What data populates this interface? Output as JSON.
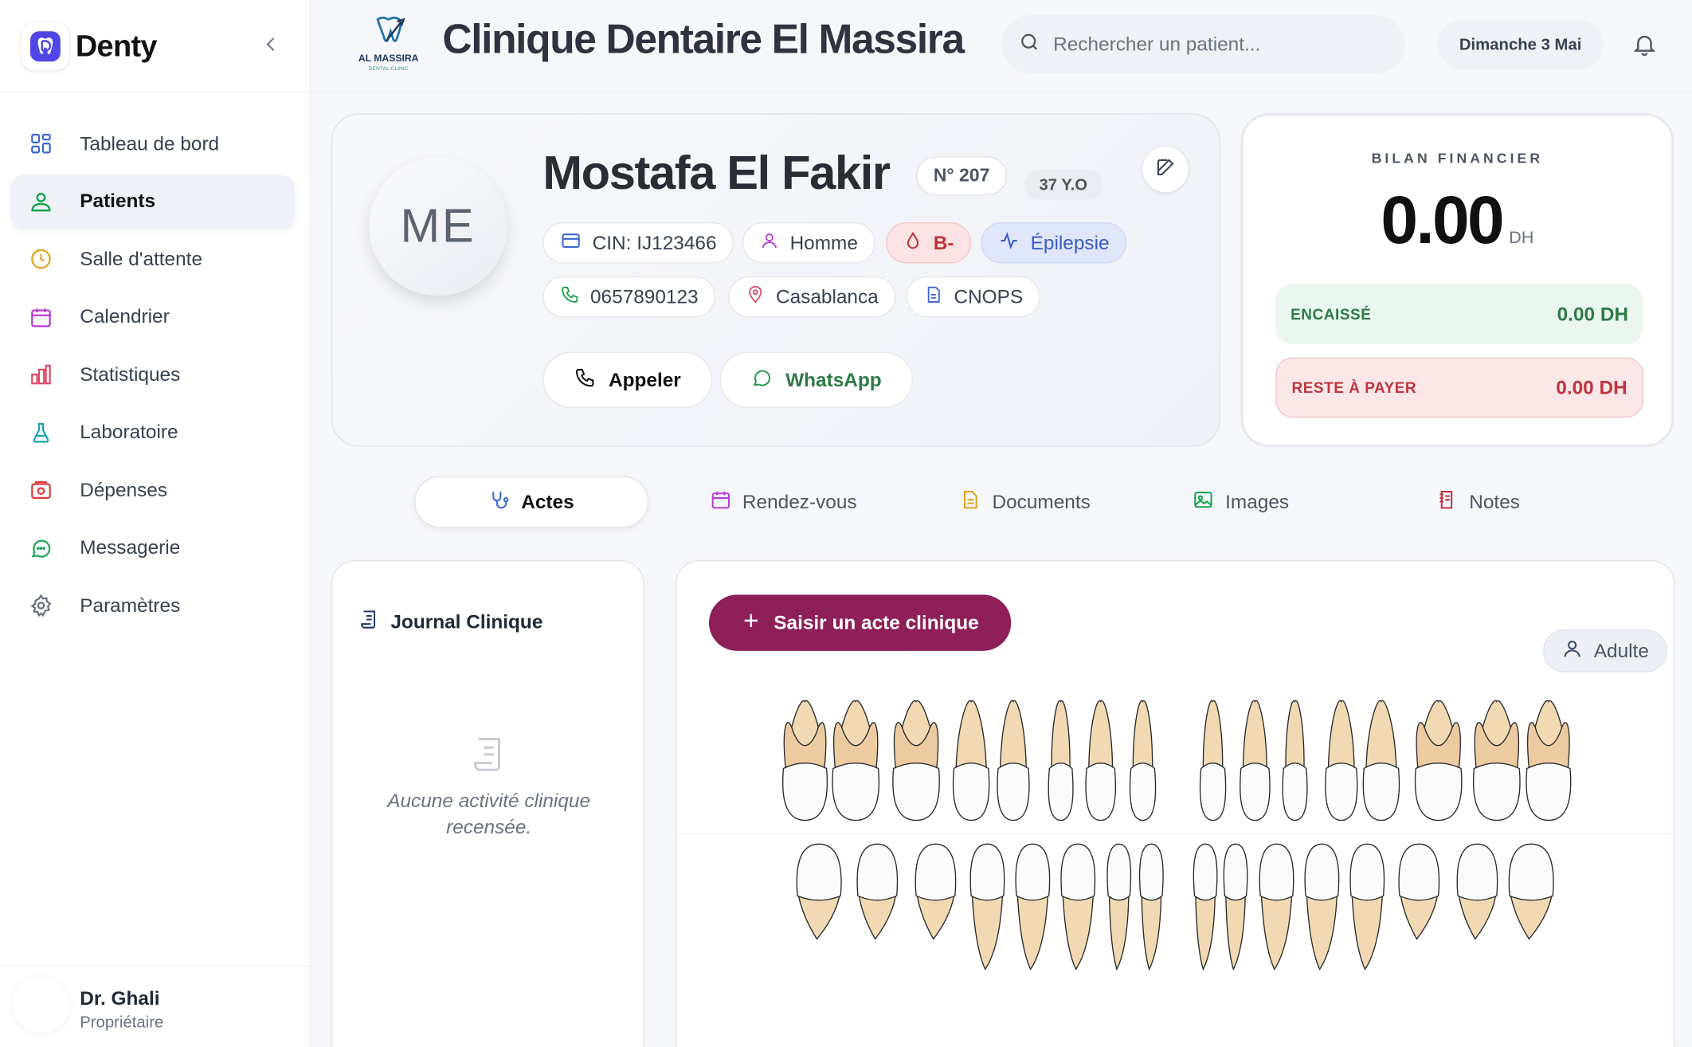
{
  "app": {
    "name": "Denty"
  },
  "sidebar": {
    "items": [
      {
        "label": "Tableau de bord",
        "icon": "dashboard-icon",
        "active": false
      },
      {
        "label": "Patients",
        "icon": "patients-icon",
        "active": true
      },
      {
        "label": "Salle d'attente",
        "icon": "clock-icon",
        "active": false
      },
      {
        "label": "Calendrier",
        "icon": "calendar-icon",
        "active": false
      },
      {
        "label": "Statistiques",
        "icon": "bar-chart-icon",
        "active": false
      },
      {
        "label": "Laboratoire",
        "icon": "flask-icon",
        "active": false
      },
      {
        "label": "Dépenses",
        "icon": "wallet-icon",
        "active": false
      },
      {
        "label": "Messagerie",
        "icon": "message-icon",
        "active": false
      },
      {
        "label": "Paramètres",
        "icon": "gear-icon",
        "active": false
      }
    ],
    "user": {
      "name": "Dr. Ghali",
      "role": "Propriétaire"
    }
  },
  "header": {
    "clinic_logo_text": "AL MASSIRA",
    "clinic_logo_sub": "DENTAL CLINIC",
    "clinic_title": "Clinique Dentaire El Massira",
    "search_placeholder": "Rechercher un patient...",
    "date": "Dimanche 3 Mai"
  },
  "patient": {
    "initials": "ME",
    "name": "Mostafa El Fakir",
    "number": "N° 207",
    "age": "37 Y.O",
    "cin": "CIN: IJ123466",
    "gender": "Homme",
    "blood": "B-",
    "condition": "Épilepsie",
    "phone": "0657890123",
    "city": "Casablanca",
    "insurance": "CNOPS",
    "actions": {
      "call": "Appeler",
      "whatsapp": "WhatsApp"
    }
  },
  "finance": {
    "title": "BILAN FINANCIER",
    "total": "0.00",
    "currency": "DH",
    "collected_label": "ENCAISSÉ",
    "collected_value": "0.00 DH",
    "remaining_label": "RESTE À PAYER",
    "remaining_value": "0.00 DH"
  },
  "tabs": [
    {
      "label": "Actes",
      "active": true,
      "icon": "stethoscope-icon"
    },
    {
      "label": "Rendez-vous",
      "active": false,
      "icon": "calendar-icon"
    },
    {
      "label": "Documents",
      "active": false,
      "icon": "document-icon"
    },
    {
      "label": "Images",
      "active": false,
      "icon": "image-icon"
    },
    {
      "label": "Notes",
      "active": false,
      "icon": "notes-icon"
    }
  ],
  "journal": {
    "title": "Journal Clinique",
    "empty": "Aucune activité clinique recensée."
  },
  "chart": {
    "add_label": "Saisir un acte clinique",
    "mode": "Adulte"
  },
  "colors": {
    "accent": "#8e1f58",
    "brand": "#4f46e5"
  }
}
